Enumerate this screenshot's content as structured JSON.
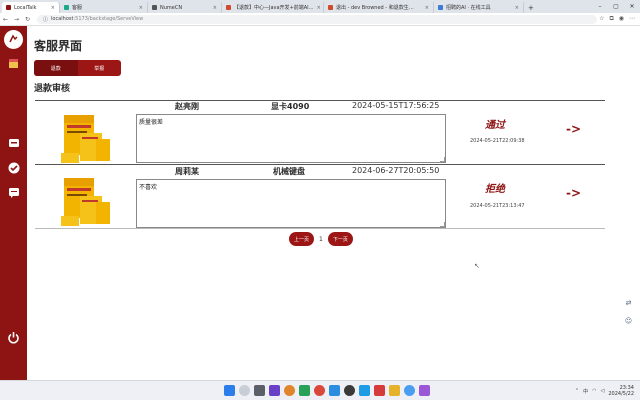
{
  "browser": {
    "tabs": [
      {
        "label": "LocalTalk",
        "color": "#8e1414",
        "active": true
      },
      {
        "label": "客服",
        "color": "#1aaa8a"
      },
      {
        "label": "NumeCN",
        "color": "#555"
      },
      {
        "label": "【退款】中心—Java开发+前端AI…",
        "color": "#d04b2b"
      },
      {
        "label": "退出 - dev Browned - 和退款生…",
        "color": "#d04b2b"
      },
      {
        "label": "招聘的AI · 在线工具",
        "color": "#3a7bd5"
      }
    ],
    "url_host": "localhost",
    "url_path": ":5173/backstage/ServeView"
  },
  "page": {
    "title": "客服界面",
    "tabs": [
      "退款",
      "举报"
    ],
    "section_title": "退款审核"
  },
  "requests": [
    {
      "user": "赵亮刚",
      "product": "显卡4090",
      "date": "2024-05-15T17:56:25",
      "reason": "质量很差",
      "status": "通过",
      "status_time": "2024-05-21T22:09:38",
      "arrow": "->"
    },
    {
      "user": "周莉某",
      "product": "机械键盘",
      "date": "2024-06-27T20:05:50",
      "reason": "不喜欢",
      "status": "拒绝",
      "status_time": "2024-05-21T23:13:47",
      "arrow": "->"
    }
  ],
  "pagination": {
    "prev": "上一页",
    "current": "1",
    "next": "下一页"
  },
  "taskbar": {
    "time": "23:34",
    "date": "2024/5/22",
    "lang": "中"
  }
}
